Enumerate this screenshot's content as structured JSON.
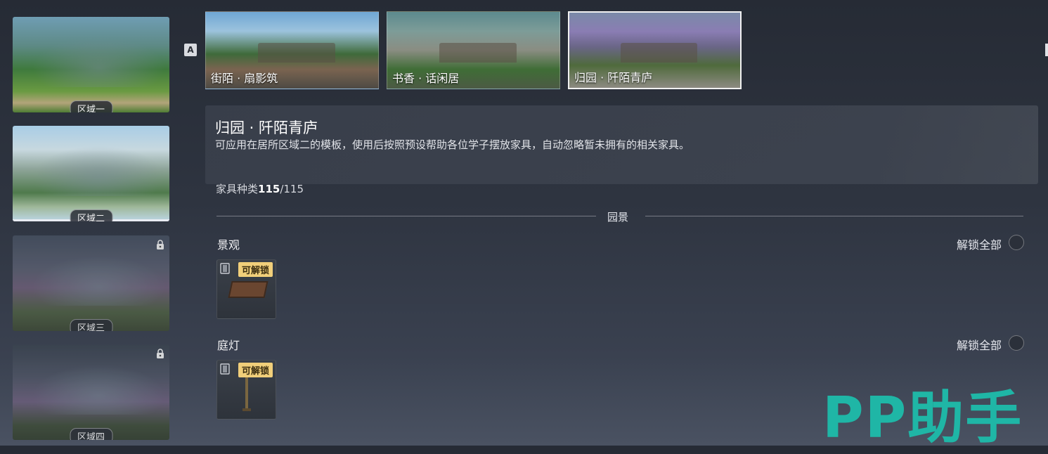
{
  "areas": [
    {
      "label": "区域一",
      "locked": false,
      "selected": false
    },
    {
      "label": "区域二",
      "locked": false,
      "selected": true
    },
    {
      "label": "区域三",
      "locked": true,
      "selected": false
    },
    {
      "label": "区域四",
      "locked": true,
      "selected": false
    }
  ],
  "hotkey": "A",
  "templates": [
    {
      "name": "街陌 · 扇影筑",
      "selected": false
    },
    {
      "name": "书香 · 话闲居",
      "selected": false
    },
    {
      "name": "归园 · 阡陌青庐",
      "selected": true
    }
  ],
  "detail": {
    "title": "归园 · 阡陌青庐",
    "description": "可应用在居所区域二的模板，使用后按照预设帮助各位学子摆放家具，自动忽略暂未拥有的相关家具。",
    "count_label": "家具种类",
    "count_owned": "115",
    "count_total": "/115"
  },
  "section": {
    "title": "园景"
  },
  "categories": [
    {
      "title": "景观",
      "unlock_all": "解锁全部",
      "items": [
        {
          "badge": "可解锁",
          "icon": "table-furniture-icon"
        }
      ]
    },
    {
      "title": "庭灯",
      "unlock_all": "解锁全部",
      "items": [
        {
          "badge": "可解锁",
          "icon": "garden-lamp-icon"
        }
      ]
    }
  ],
  "watermark": "PP助手",
  "colors": {
    "badge": "#f1cf7a",
    "watermark": "#1fb6a6"
  }
}
